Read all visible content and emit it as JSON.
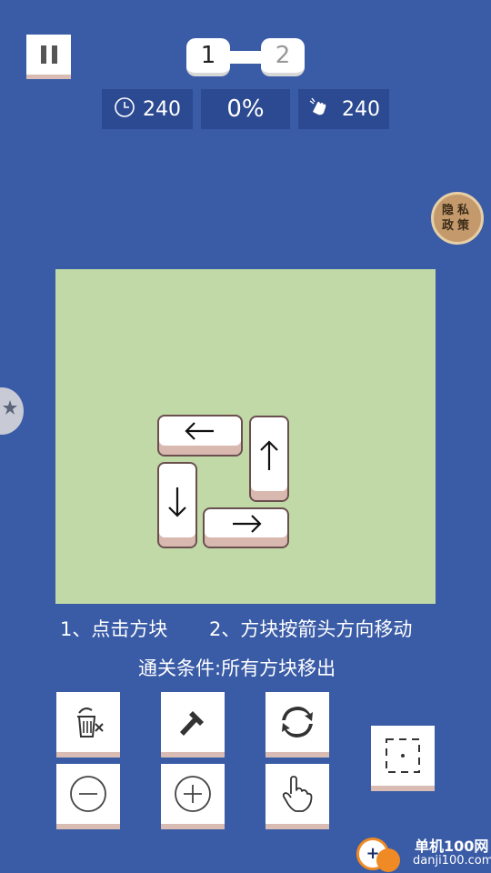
{
  "header": {
    "level_current": "1",
    "level_next": "2",
    "time_value": "240",
    "progress_value": "0%",
    "moves_value": "240"
  },
  "privacy": {
    "line1": "隐私",
    "line2": "政策"
  },
  "board": {
    "blocks": [
      {
        "name": "block-left-arrow",
        "direction": "left"
      },
      {
        "name": "block-up-arrow",
        "direction": "up"
      },
      {
        "name": "block-down-arrow",
        "direction": "down"
      },
      {
        "name": "block-right-arrow",
        "direction": "right"
      }
    ],
    "background_color": "#c0d9a7"
  },
  "instructions": {
    "step1": "1、点击方块",
    "step2": "2、方块按箭头方向移动",
    "goal": "通关条件:所有方块移出"
  },
  "toolbar": {
    "icons": [
      "trash-icon",
      "hammer-icon",
      "refresh-icon",
      "zoom-out-icon",
      "zoom-in-icon",
      "hand-pointer-icon",
      "select-area-icon"
    ]
  },
  "watermark": {
    "title": "单机100网",
    "url": "danji100.com"
  },
  "colors": {
    "background": "#3a5ba6",
    "stat_bg": "#2c4a91",
    "board": "#c0d9a7",
    "badge": "#c49a6c"
  }
}
